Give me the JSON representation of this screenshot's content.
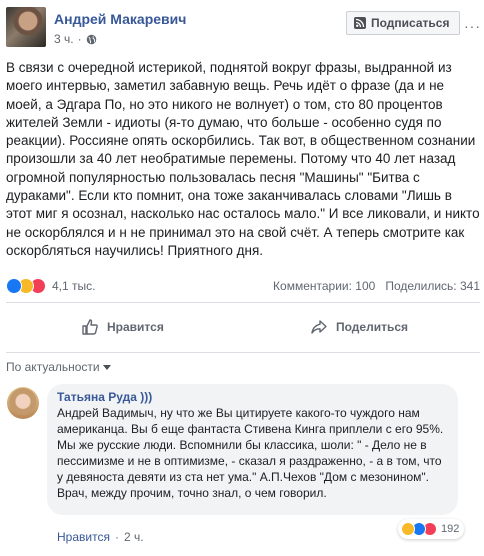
{
  "post": {
    "author": "Андрей Макаревич",
    "time": "3 ч.",
    "subscribe_label": "Подписаться",
    "more": "···",
    "text": "В связи с очередной истерикой, поднятой вокруг фразы, выдранной из моего интервью, заметил забавную вещь. Речь идёт о фразе (да и не моей, а Эдгара По, но это никого не волнует) о том, сто 80 процентов жителей Земли - идиоты (я-то думаю, что больше - особенно судя по реакции). Россияне опять оскорбились. Так вот, в общественном сознании произошли за 40 лет необратимые перемены. Потому что 40 лет назад огромной популярностью пользовалась песня \"Машины\" \"Битва с дураками\". Если кто помнит, она тоже заканчивалась словами \"Лишь в этот миг я осознал, насколько нас осталось мало.\" И все ликовали, и никто не оскорблялся и н не принимал это на свой счёт. А теперь смотрите как оскорбляться научились! Приятного дня.",
    "reactions_count": "4,1 тыс.",
    "comments_count": "Комментарии: 100",
    "shares_count": "Поделились: 341"
  },
  "actions": {
    "like_label": "Нравится",
    "share_label": "Поделиться"
  },
  "comments": {
    "sort_label": "По актуальности",
    "items": [
      {
        "author": "Татьяна Руда )))",
        "text": "Андрей Вадимыч, ну что же Вы цитируете какого-то чуждого нам американца. Вы б еще фантаста Стивена Кинга приплели с его 95%. Мы же русские люди. Вспомнили бы классика, шоли: \" - Дело не в пессимизме и не в оптимизме, - сказал я раздраженно, - а в том, что у девяноста девяти из ста нет ума.\" А.П.Чехов \"Дом с мезонином\". Врач, между прочим, точно знал, о чем говорил.",
        "reactions_count": "192",
        "like_label": "Нравится",
        "separator": "·",
        "time": "2 ч."
      }
    ]
  },
  "colors": {
    "link": "#385898",
    "secondary_text": "#606770",
    "like_blue": "#1877f2",
    "haha_yellow": "#f7b928",
    "love_red": "#f33e58",
    "bubble_bg": "#f2f3f5"
  }
}
